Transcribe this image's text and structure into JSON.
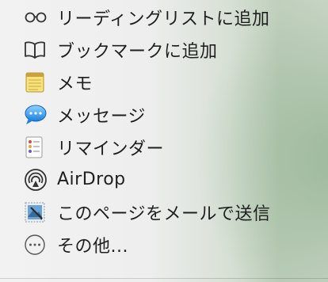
{
  "menu": {
    "items": [
      {
        "label": "リーディングリストに追加",
        "icon": "reading-list-glasses-icon"
      },
      {
        "label": "ブックマークに追加",
        "icon": "book-icon"
      },
      {
        "label": "メモ",
        "icon": "notes-app-icon"
      },
      {
        "label": "メッセージ",
        "icon": "messages-app-icon"
      },
      {
        "label": "リマインダー",
        "icon": "reminders-app-icon"
      },
      {
        "label": "AirDrop",
        "icon": "airdrop-icon"
      },
      {
        "label": "このページをメールで送信",
        "icon": "mail-stamp-icon"
      },
      {
        "label": "その他...",
        "icon": "more-ellipsis-icon"
      }
    ]
  }
}
